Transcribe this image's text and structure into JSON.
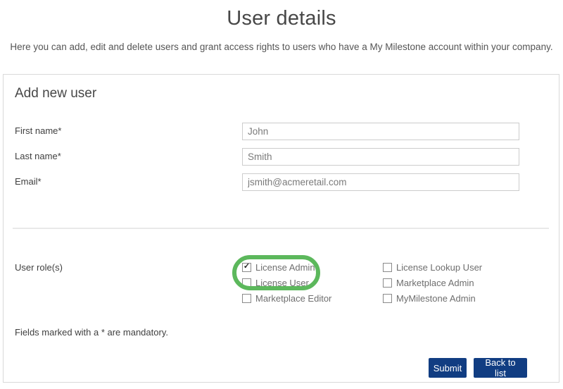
{
  "page": {
    "title": "User details",
    "subtitle": "Here you can add, edit and delete users and grant access rights to users who have a My Milestone account within your company."
  },
  "panel": {
    "heading": "Add new user",
    "fields": [
      {
        "label": "First name*",
        "value": "John"
      },
      {
        "label": "Last name*",
        "value": "Smith"
      },
      {
        "label": "Email*",
        "value": "jsmith@acmeretail.com"
      }
    ],
    "roles": {
      "label": "User role(s)",
      "check_glyph": "✓",
      "items": [
        {
          "label": "License Admin",
          "checked": true
        },
        {
          "label": "License User",
          "checked": false
        },
        {
          "label": "Marketplace Editor",
          "checked": false
        },
        {
          "label": "License Lookup User",
          "checked": false
        },
        {
          "label": "Marketplace Admin",
          "checked": false
        },
        {
          "label": "MyMilestone Admin",
          "checked": false
        }
      ]
    },
    "note": "Fields marked with a * are mandatory.",
    "buttons": {
      "submit": "Submit",
      "back": "Back to list"
    }
  },
  "colors": {
    "button_bg": "#113d82",
    "highlight_green": "#5cb85c",
    "panel_border": "#d9d9d9"
  }
}
